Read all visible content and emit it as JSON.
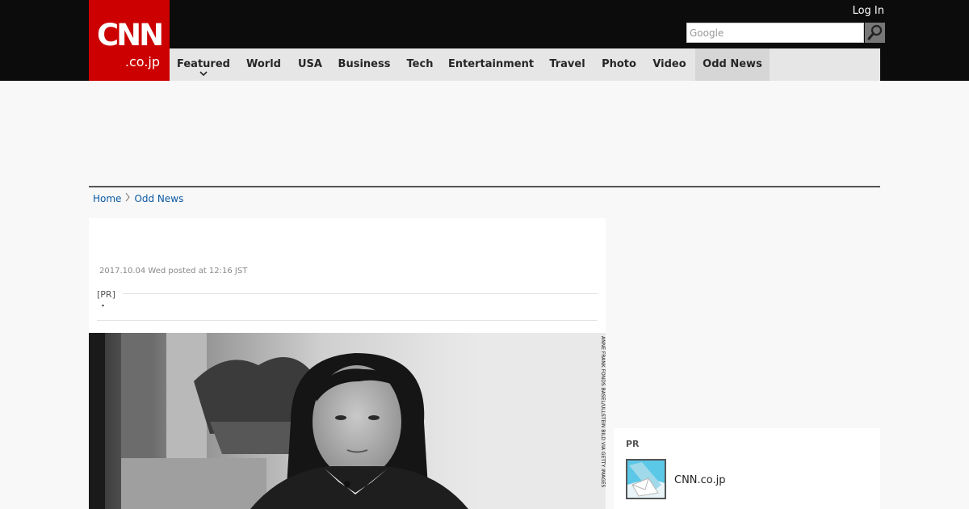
{
  "header": {
    "logo": {
      "main": "CNN",
      "sub": ".co.jp"
    },
    "login_label": "Log In",
    "search": {
      "placeholder": "Google"
    }
  },
  "nav": {
    "items": [
      {
        "label": "Featured"
      },
      {
        "label": "World"
      },
      {
        "label": "USA"
      },
      {
        "label": "Business"
      },
      {
        "label": "Tech"
      },
      {
        "label": "Entertainment"
      },
      {
        "label": "Travel"
      },
      {
        "label": "Photo"
      },
      {
        "label": "Video"
      },
      {
        "label": "Odd News"
      }
    ],
    "active": "Odd News"
  },
  "breadcrumb": {
    "items": [
      {
        "label": "Home"
      },
      {
        "label": "Odd News"
      }
    ]
  },
  "article": {
    "dateline": "2017.10.04 Wed posted at 12:16 JST",
    "pr_label": "[PR]",
    "pr_text": "・",
    "photo_credit": "ANNE FRANK FONDS BASEL/ULLSTEIN BILD VIA GETTY IMAGES"
  },
  "sidebar": {
    "pr_title": "PR",
    "pr_items": [
      {
        "label": "CNN.co.jp"
      }
    ]
  },
  "colors": {
    "brand_red": "#cc0000",
    "topbar": "#0c0c0c",
    "nav_bg": "#e6e6e6",
    "link_blue": "#0b5aa5"
  }
}
